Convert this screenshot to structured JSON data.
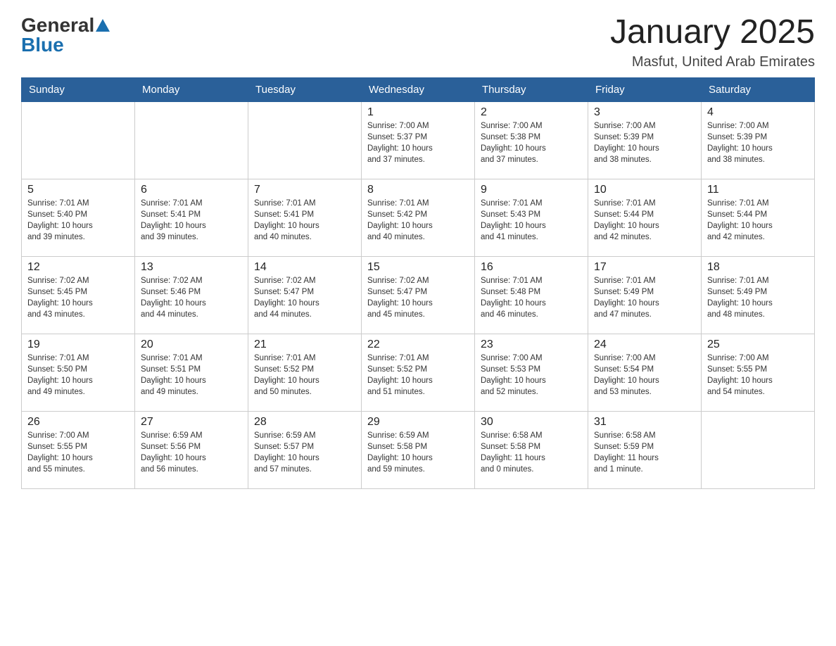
{
  "header": {
    "logo_general": "General",
    "logo_blue": "Blue",
    "title": "January 2025",
    "subtitle": "Masfut, United Arab Emirates"
  },
  "weekdays": [
    "Sunday",
    "Monday",
    "Tuesday",
    "Wednesday",
    "Thursday",
    "Friday",
    "Saturday"
  ],
  "weeks": [
    [
      {
        "day": "",
        "info": ""
      },
      {
        "day": "",
        "info": ""
      },
      {
        "day": "",
        "info": ""
      },
      {
        "day": "1",
        "info": "Sunrise: 7:00 AM\nSunset: 5:37 PM\nDaylight: 10 hours\nand 37 minutes."
      },
      {
        "day": "2",
        "info": "Sunrise: 7:00 AM\nSunset: 5:38 PM\nDaylight: 10 hours\nand 37 minutes."
      },
      {
        "day": "3",
        "info": "Sunrise: 7:00 AM\nSunset: 5:39 PM\nDaylight: 10 hours\nand 38 minutes."
      },
      {
        "day": "4",
        "info": "Sunrise: 7:00 AM\nSunset: 5:39 PM\nDaylight: 10 hours\nand 38 minutes."
      }
    ],
    [
      {
        "day": "5",
        "info": "Sunrise: 7:01 AM\nSunset: 5:40 PM\nDaylight: 10 hours\nand 39 minutes."
      },
      {
        "day": "6",
        "info": "Sunrise: 7:01 AM\nSunset: 5:41 PM\nDaylight: 10 hours\nand 39 minutes."
      },
      {
        "day": "7",
        "info": "Sunrise: 7:01 AM\nSunset: 5:41 PM\nDaylight: 10 hours\nand 40 minutes."
      },
      {
        "day": "8",
        "info": "Sunrise: 7:01 AM\nSunset: 5:42 PM\nDaylight: 10 hours\nand 40 minutes."
      },
      {
        "day": "9",
        "info": "Sunrise: 7:01 AM\nSunset: 5:43 PM\nDaylight: 10 hours\nand 41 minutes."
      },
      {
        "day": "10",
        "info": "Sunrise: 7:01 AM\nSunset: 5:44 PM\nDaylight: 10 hours\nand 42 minutes."
      },
      {
        "day": "11",
        "info": "Sunrise: 7:01 AM\nSunset: 5:44 PM\nDaylight: 10 hours\nand 42 minutes."
      }
    ],
    [
      {
        "day": "12",
        "info": "Sunrise: 7:02 AM\nSunset: 5:45 PM\nDaylight: 10 hours\nand 43 minutes."
      },
      {
        "day": "13",
        "info": "Sunrise: 7:02 AM\nSunset: 5:46 PM\nDaylight: 10 hours\nand 44 minutes."
      },
      {
        "day": "14",
        "info": "Sunrise: 7:02 AM\nSunset: 5:47 PM\nDaylight: 10 hours\nand 44 minutes."
      },
      {
        "day": "15",
        "info": "Sunrise: 7:02 AM\nSunset: 5:47 PM\nDaylight: 10 hours\nand 45 minutes."
      },
      {
        "day": "16",
        "info": "Sunrise: 7:01 AM\nSunset: 5:48 PM\nDaylight: 10 hours\nand 46 minutes."
      },
      {
        "day": "17",
        "info": "Sunrise: 7:01 AM\nSunset: 5:49 PM\nDaylight: 10 hours\nand 47 minutes."
      },
      {
        "day": "18",
        "info": "Sunrise: 7:01 AM\nSunset: 5:49 PM\nDaylight: 10 hours\nand 48 minutes."
      }
    ],
    [
      {
        "day": "19",
        "info": "Sunrise: 7:01 AM\nSunset: 5:50 PM\nDaylight: 10 hours\nand 49 minutes."
      },
      {
        "day": "20",
        "info": "Sunrise: 7:01 AM\nSunset: 5:51 PM\nDaylight: 10 hours\nand 49 minutes."
      },
      {
        "day": "21",
        "info": "Sunrise: 7:01 AM\nSunset: 5:52 PM\nDaylight: 10 hours\nand 50 minutes."
      },
      {
        "day": "22",
        "info": "Sunrise: 7:01 AM\nSunset: 5:52 PM\nDaylight: 10 hours\nand 51 minutes."
      },
      {
        "day": "23",
        "info": "Sunrise: 7:00 AM\nSunset: 5:53 PM\nDaylight: 10 hours\nand 52 minutes."
      },
      {
        "day": "24",
        "info": "Sunrise: 7:00 AM\nSunset: 5:54 PM\nDaylight: 10 hours\nand 53 minutes."
      },
      {
        "day": "25",
        "info": "Sunrise: 7:00 AM\nSunset: 5:55 PM\nDaylight: 10 hours\nand 54 minutes."
      }
    ],
    [
      {
        "day": "26",
        "info": "Sunrise: 7:00 AM\nSunset: 5:55 PM\nDaylight: 10 hours\nand 55 minutes."
      },
      {
        "day": "27",
        "info": "Sunrise: 6:59 AM\nSunset: 5:56 PM\nDaylight: 10 hours\nand 56 minutes."
      },
      {
        "day": "28",
        "info": "Sunrise: 6:59 AM\nSunset: 5:57 PM\nDaylight: 10 hours\nand 57 minutes."
      },
      {
        "day": "29",
        "info": "Sunrise: 6:59 AM\nSunset: 5:58 PM\nDaylight: 10 hours\nand 59 minutes."
      },
      {
        "day": "30",
        "info": "Sunrise: 6:58 AM\nSunset: 5:58 PM\nDaylight: 11 hours\nand 0 minutes."
      },
      {
        "day": "31",
        "info": "Sunrise: 6:58 AM\nSunset: 5:59 PM\nDaylight: 11 hours\nand 1 minute."
      },
      {
        "day": "",
        "info": ""
      }
    ]
  ]
}
